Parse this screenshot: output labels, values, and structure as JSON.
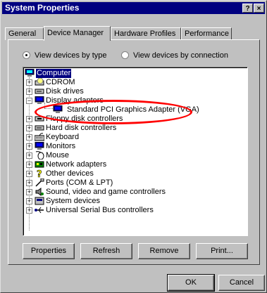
{
  "window": {
    "title": "System Properties",
    "help_button": "?",
    "close_button": "×"
  },
  "tabs": [
    {
      "label": "General"
    },
    {
      "label": "Device Manager"
    },
    {
      "label": "Hardware Profiles"
    },
    {
      "label": "Performance"
    }
  ],
  "view_options": {
    "by_type": "View devices by type",
    "by_connection": "View devices by connection",
    "selected": "by_type"
  },
  "tree": {
    "root": "Computer",
    "items": [
      {
        "label": "CDROM",
        "icon": "cdrom-icon"
      },
      {
        "label": "Disk drives",
        "icon": "disk-drive-icon"
      },
      {
        "label": "Display adapters",
        "icon": "display-adapter-icon",
        "expanded": true
      },
      {
        "label": "Standard PCI Graphics Adapter (VGA)",
        "icon": "monitor-icon",
        "child": true
      },
      {
        "label": "Floppy disk controllers",
        "icon": "floppy-controller-icon"
      },
      {
        "label": "Hard disk controllers",
        "icon": "hard-disk-controller-icon"
      },
      {
        "label": "Keyboard",
        "icon": "keyboard-icon"
      },
      {
        "label": "Monitors",
        "icon": "monitor-icon"
      },
      {
        "label": "Mouse",
        "icon": "mouse-icon"
      },
      {
        "label": "Network adapters",
        "icon": "network-adapter-icon"
      },
      {
        "label": "Other devices",
        "icon": "question-mark-icon"
      },
      {
        "label": "Ports (COM & LPT)",
        "icon": "port-icon"
      },
      {
        "label": "Sound, video and game controllers",
        "icon": "sound-icon"
      },
      {
        "label": "System devices",
        "icon": "system-device-icon"
      },
      {
        "label": "Universal Serial Bus controllers",
        "icon": "usb-icon"
      }
    ]
  },
  "buttons": {
    "properties": "Properties",
    "refresh": "Refresh",
    "remove": "Remove",
    "print": "Print...",
    "ok": "OK",
    "cancel": "Cancel"
  },
  "colors": {
    "titlebar": "#000080",
    "face": "#c0c0c0",
    "highlight_ellipse": "#ff0000"
  }
}
